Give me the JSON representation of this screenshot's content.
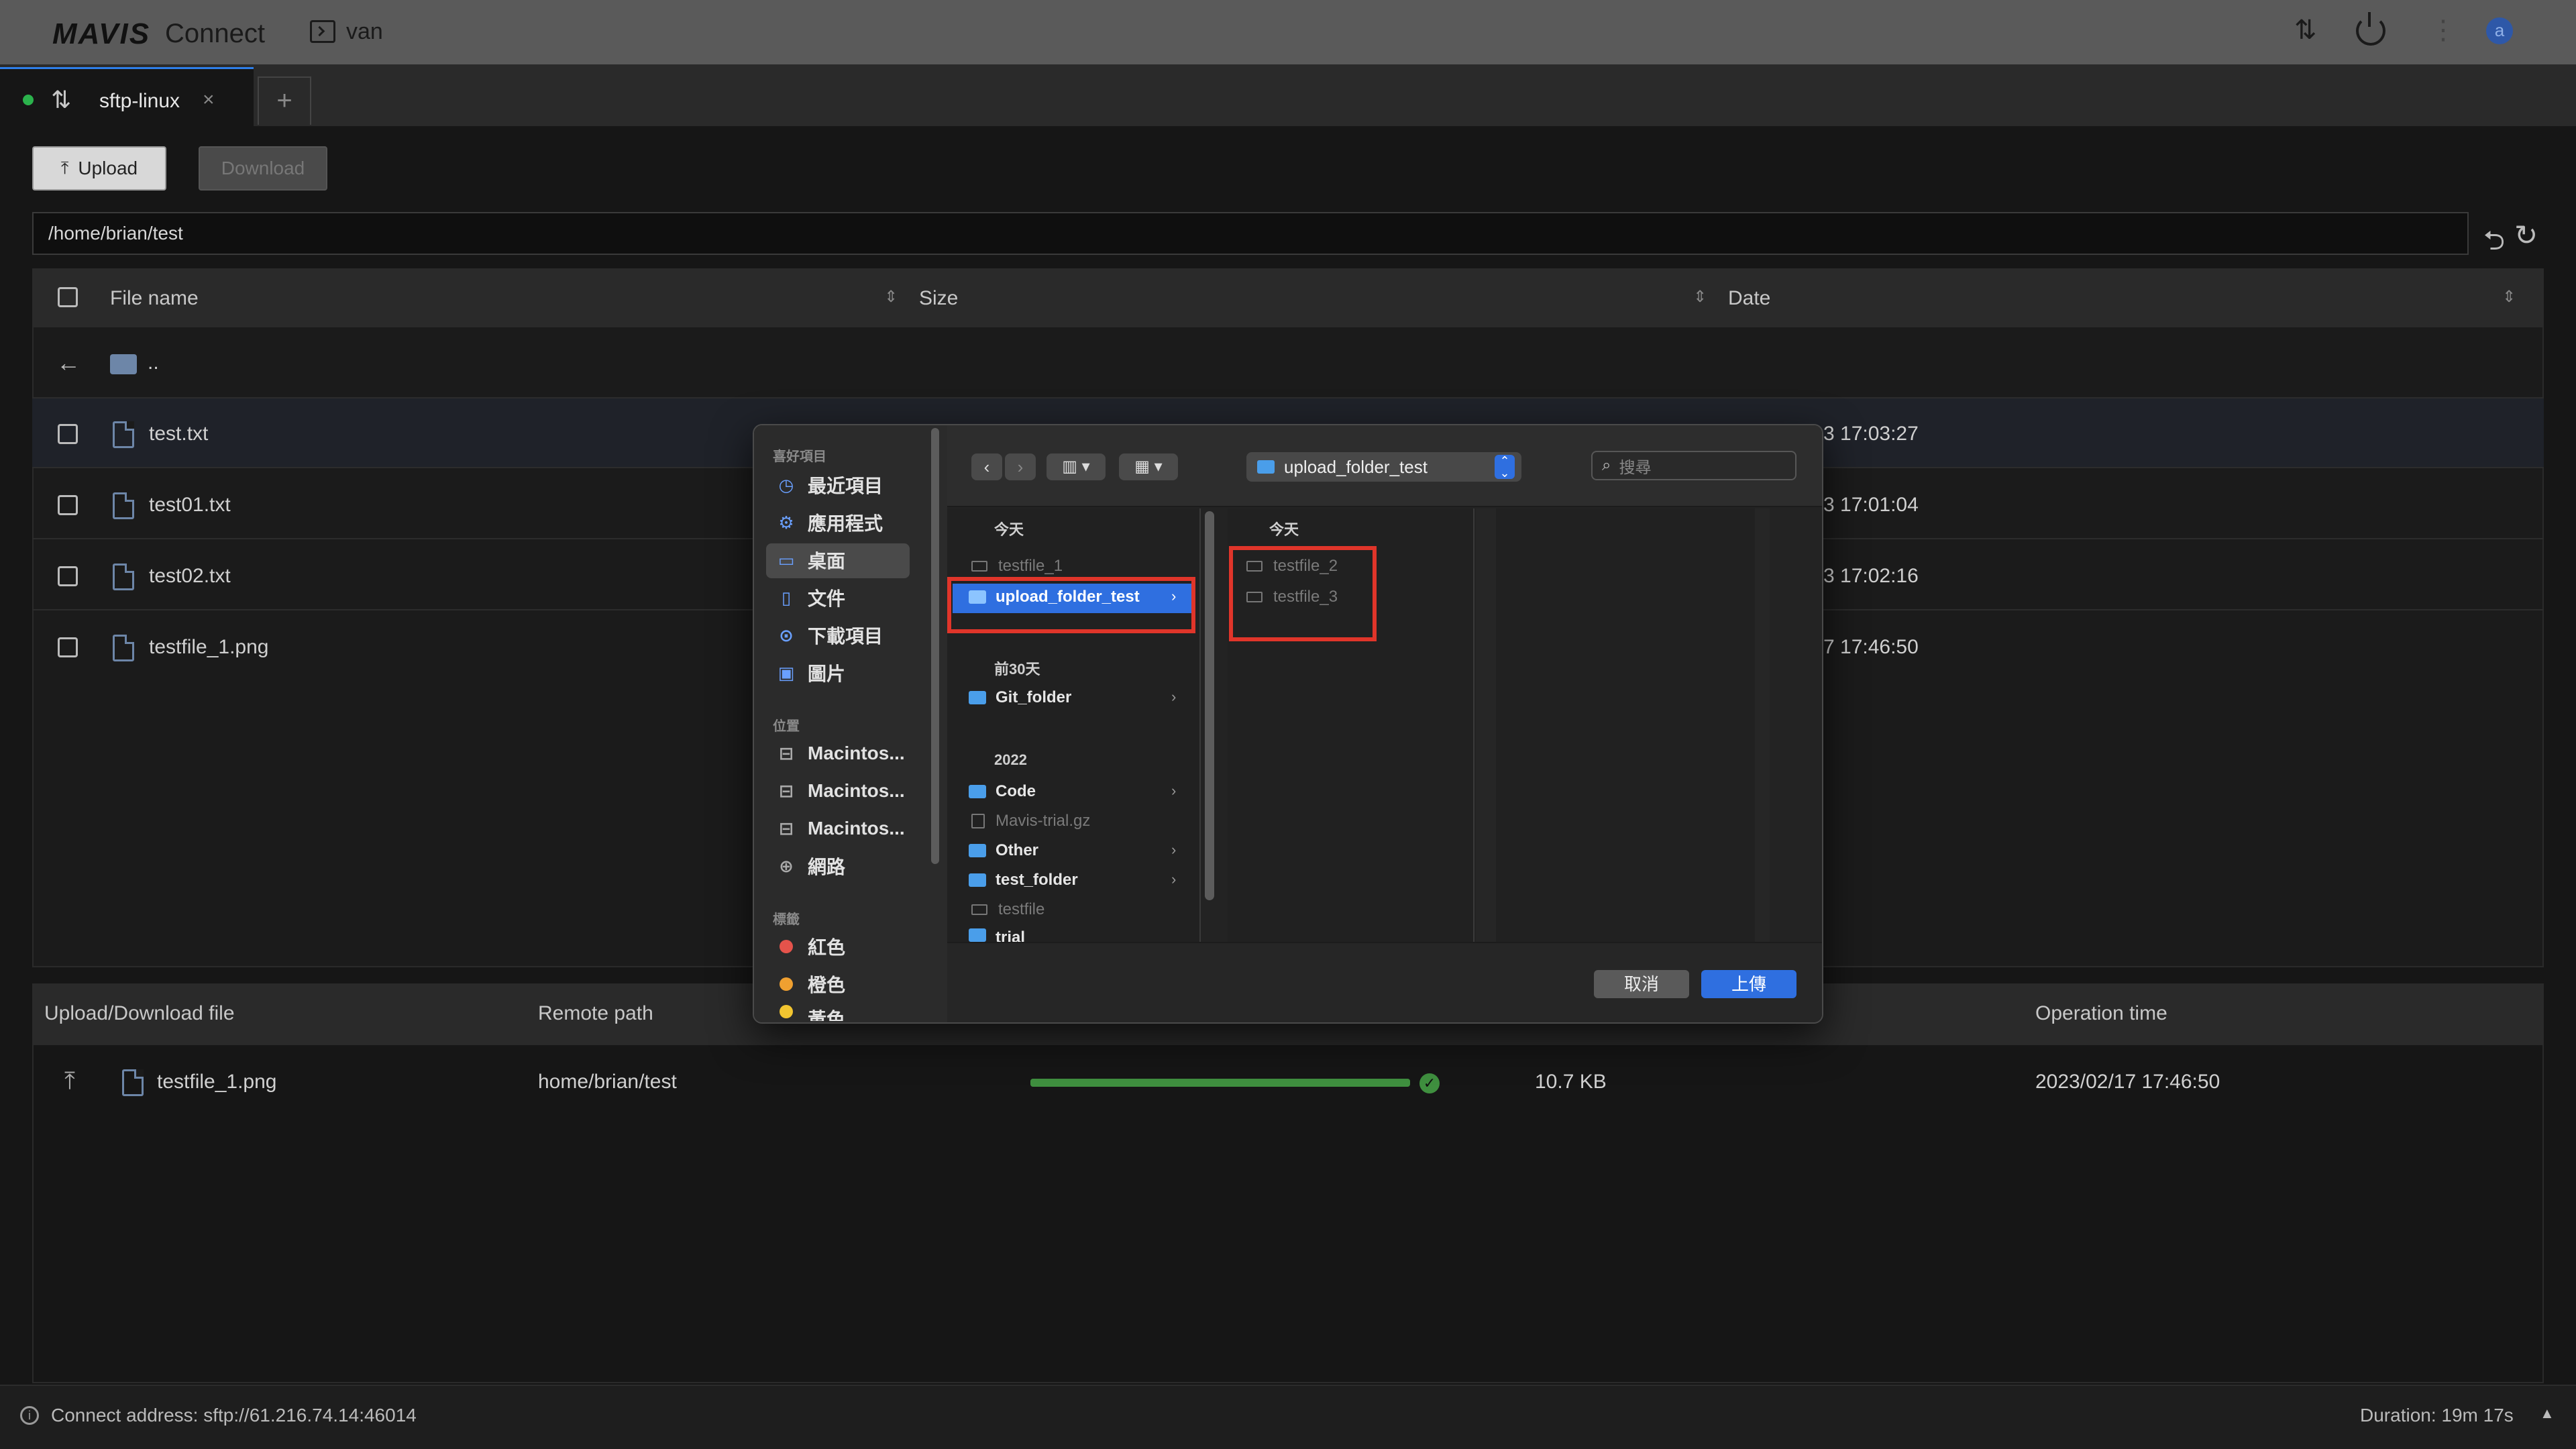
{
  "app": {
    "logo": "MAVIS",
    "name": "Connect",
    "session": "van",
    "avatar_letter": "a"
  },
  "tabs": [
    {
      "label": "sftp-linux",
      "status_color": "#2bb24c"
    }
  ],
  "toolbar": {
    "upload_label": "Upload",
    "download_label": "Download"
  },
  "path": "/home/brian/test",
  "file_table": {
    "headers": {
      "name": "File name",
      "size": "Size",
      "date": "Date"
    },
    "parent_label": "..",
    "rows": [
      {
        "name": "test.txt",
        "date": "3 17:03:27"
      },
      {
        "name": "test01.txt",
        "date": "3 17:01:04"
      },
      {
        "name": "test02.txt",
        "date": "3 17:02:16"
      },
      {
        "name": "testfile_1.png",
        "date": "7 17:46:50"
      }
    ]
  },
  "transfer": {
    "headers": {
      "file": "Upload/Download file",
      "remote": "Remote path",
      "time": "Operation time"
    },
    "rows": [
      {
        "file": "testfile_1.png",
        "remote": "home/brian/test",
        "progress": 1.0,
        "size": "10.7 KB",
        "time": "2023/02/17 17:46:50"
      }
    ]
  },
  "status": {
    "address": "Connect address: sftp://61.216.74.14:46014",
    "duration": "Duration: 19m 17s"
  },
  "dialog": {
    "sidebar": {
      "favorites_title": "喜好項目",
      "favorites": [
        {
          "label": "最近項目",
          "icon": "clock-icon"
        },
        {
          "label": "應用程式",
          "icon": "apps-icon"
        },
        {
          "label": "桌面",
          "icon": "desktop-icon"
        },
        {
          "label": "文件",
          "icon": "document-icon"
        },
        {
          "label": "下載項目",
          "icon": "download-icon"
        },
        {
          "label": "圖片",
          "icon": "picture-icon"
        }
      ],
      "locations_title": "位置",
      "locations": [
        {
          "label": "Macintos...",
          "icon": "drive-icon"
        },
        {
          "label": "Macintos...",
          "icon": "drive-icon"
        },
        {
          "label": "Macintos...",
          "icon": "drive-icon"
        },
        {
          "label": "網路",
          "icon": "globe-icon"
        }
      ],
      "tags_title": "標籤",
      "tags": [
        {
          "label": "紅色",
          "color": "#e5534b"
        },
        {
          "label": "橙色",
          "color": "#f0a030"
        },
        {
          "label": "黃色",
          "color": "#f2c530"
        }
      ]
    },
    "location": "upload_folder_test",
    "search_placeholder": "搜尋",
    "col1": {
      "today": "今天",
      "today_items": [
        {
          "name": "testfile_1",
          "type": "file"
        },
        {
          "name": "upload_folder_test",
          "type": "folder"
        }
      ],
      "past30": "前30天",
      "past30_items": [
        {
          "name": "Git_folder",
          "type": "folder"
        }
      ],
      "year": "2022",
      "year_items": [
        {
          "name": "Code",
          "type": "folder"
        },
        {
          "name": "Mavis-trial.gz",
          "type": "file"
        },
        {
          "name": "Other",
          "type": "folder"
        },
        {
          "name": "test_folder",
          "type": "folder"
        },
        {
          "name": "testfile",
          "type": "file"
        },
        {
          "name": "trial",
          "type": "folder"
        }
      ]
    },
    "col2": {
      "today": "今天",
      "items": [
        {
          "name": "testfile_2"
        },
        {
          "name": "testfile_3"
        }
      ]
    },
    "cancel_label": "取消",
    "upload_label": "上傳"
  }
}
